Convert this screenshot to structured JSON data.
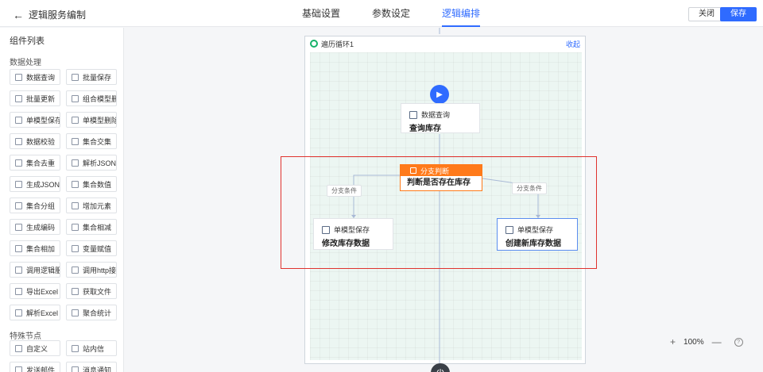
{
  "header": {
    "back_label": "逻辑服务编制",
    "tabs": [
      {
        "label": "基础设置",
        "active": false
      },
      {
        "label": "参数设定",
        "active": false
      },
      {
        "label": "逻辑编排",
        "active": true
      }
    ],
    "close_label": "关闭",
    "save_label": "保存"
  },
  "left_panel": {
    "title": "组件列表",
    "sections": [
      {
        "title": "数据处理",
        "items": [
          {
            "label": "数据查询",
            "icon": "table-search-icon"
          },
          {
            "label": "批量保存",
            "icon": "save-icon"
          },
          {
            "label": "批量更新",
            "icon": "refresh-icon"
          },
          {
            "label": "组合模型删除",
            "icon": "delete-icon"
          },
          {
            "label": "单模型保存",
            "icon": "save-icon"
          },
          {
            "label": "单模型删除",
            "icon": "delete-icon"
          },
          {
            "label": "数据校验",
            "icon": "check-icon"
          },
          {
            "label": "集合交集",
            "icon": "intersect-icon"
          },
          {
            "label": "集合去重",
            "icon": "dedupe-icon"
          },
          {
            "label": "解析JSON",
            "icon": "json-icon"
          },
          {
            "label": "生成JSON",
            "icon": "json-icon"
          },
          {
            "label": "集合数值",
            "icon": "number-icon"
          },
          {
            "label": "集合分组",
            "icon": "group-icon"
          },
          {
            "label": "增加元素",
            "icon": "plus-icon"
          },
          {
            "label": "生成编码",
            "icon": "code-icon"
          },
          {
            "label": "集合相减",
            "icon": "minus-icon"
          },
          {
            "label": "集合相加",
            "icon": "plus-icon"
          },
          {
            "label": "变量赋值",
            "icon": "variable-icon"
          },
          {
            "label": "调用逻辑服务",
            "icon": "service-icon"
          },
          {
            "label": "调用http接口",
            "icon": "http-icon"
          },
          {
            "label": "导出Excel",
            "icon": "export-icon"
          },
          {
            "label": "获取文件",
            "icon": "file-icon"
          },
          {
            "label": "解析Excel",
            "icon": "excel-icon"
          },
          {
            "label": "聚合统计",
            "icon": "stats-icon"
          }
        ]
      },
      {
        "title": "特殊节点",
        "items": [
          {
            "label": "自定义",
            "icon": "custom-icon"
          },
          {
            "label": "站内信",
            "icon": "message-icon"
          },
          {
            "label": "发送邮件",
            "icon": "mail-icon"
          },
          {
            "label": "消息通知",
            "icon": "bell-icon"
          }
        ]
      }
    ]
  },
  "canvas": {
    "loop": {
      "name": "遍历循环1",
      "collapse_label": "收起"
    },
    "nodes": {
      "query": {
        "type": "数据查询",
        "label": "查询库存"
      },
      "branch": {
        "type": "分支判断",
        "label": "判断是否存在库存"
      },
      "left": {
        "type": "单模型保存",
        "label": "修改库存数据"
      },
      "right": {
        "type": "单模型保存",
        "label": "创建新库存数据"
      }
    },
    "condition_left": "分支条件",
    "condition_right": "分支条件",
    "accent_color": "#2f6bff",
    "branch_color": "#ff7a1a",
    "highlight_color": "#e0332f"
  },
  "zoom": {
    "level": "100%",
    "zoom_in": "+",
    "zoom_out": "—"
  }
}
